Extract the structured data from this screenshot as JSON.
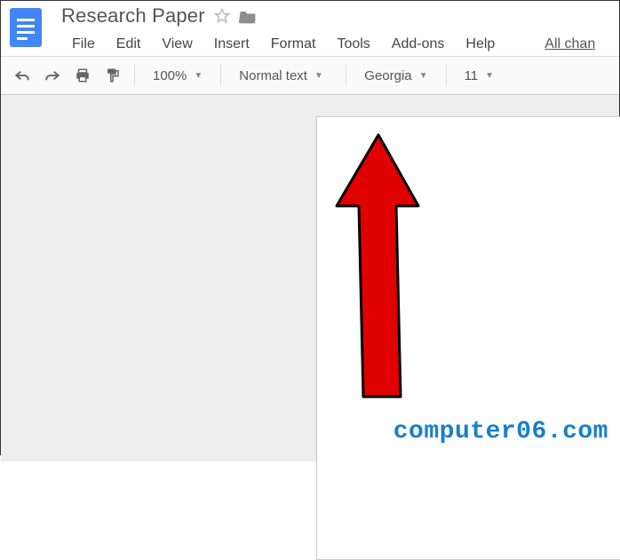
{
  "header": {
    "doc_title": "Research Paper"
  },
  "menu": {
    "file": "File",
    "edit": "Edit",
    "view": "View",
    "insert": "Insert",
    "format": "Format",
    "tools": "Tools",
    "addons": "Add-ons",
    "help": "Help",
    "changes_link": "All chan"
  },
  "toolbar": {
    "zoom": "100%",
    "style": "Normal text",
    "font": "Georgia",
    "font_size": "11"
  },
  "watermark": "computer06.com"
}
